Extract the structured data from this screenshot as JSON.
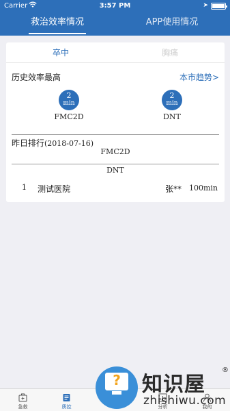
{
  "status_bar": {
    "carrier": "Carrier",
    "time": "3:57 PM"
  },
  "top_tabs": [
    {
      "label": "救治效率情况",
      "active": true
    },
    {
      "label": "APP使用情况",
      "active": false
    }
  ],
  "sub_tabs": [
    {
      "label": "卒中",
      "active": true
    },
    {
      "label": "胸痛",
      "active": false
    }
  ],
  "history": {
    "title": "历史效率最高",
    "trend_link": "本市趋势>",
    "metrics": [
      {
        "value": "2",
        "unit": "min",
        "label": "FMC2D"
      },
      {
        "value": "2",
        "unit": "min",
        "label": "DNT"
      }
    ]
  },
  "ranking": {
    "title": "昨日排行",
    "date": "(2018-07-16)",
    "section_fmc2d": "FMC2D",
    "section_dnt": "DNT",
    "rows": [
      {
        "index": "1",
        "hospital": "测试医院",
        "person": "张**",
        "duration": "100min"
      }
    ]
  },
  "tab_bar": [
    {
      "label": "急救",
      "icon": "first-aid-icon"
    },
    {
      "label": "质控",
      "icon": "quality-control-icon",
      "active": true
    },
    {
      "label": "分析",
      "icon": "analysis-icon"
    },
    {
      "label": "我的",
      "icon": "profile-icon"
    }
  ],
  "watermark": {
    "title": "知识屋",
    "domain": "zhishiwu.com",
    "mark": "®"
  },
  "colors": {
    "primary": "#2d6fb9",
    "background": "#efeff4",
    "card": "#ffffff"
  }
}
